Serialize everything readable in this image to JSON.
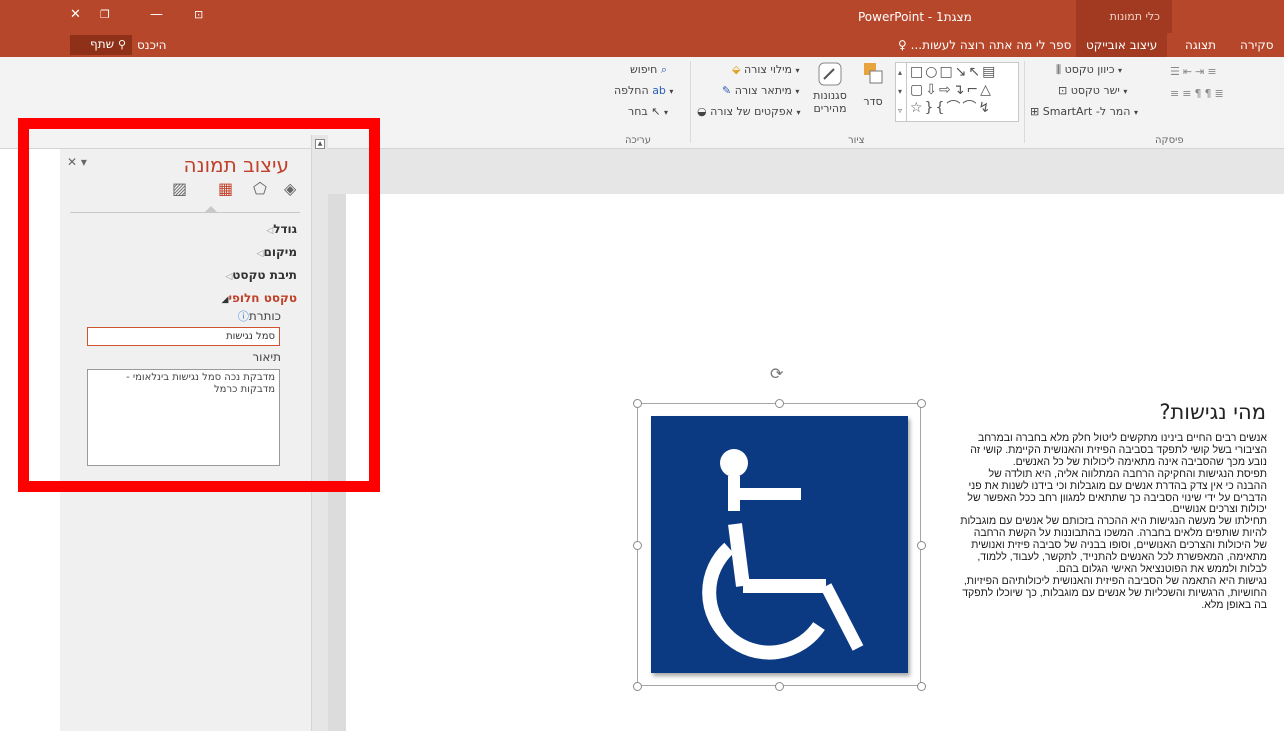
{
  "titlebar": {
    "title": "מצגת1 - PowerPoint",
    "context_tab_group": "כלי תמונות"
  },
  "tabs": {
    "share": "שתף",
    "signin": "היכנס",
    "tell_me": "ספר לי מה אתה רוצה לעשות...",
    "items": [
      "סקירה",
      "תצוגה",
      "עיצוב אובייקט"
    ]
  },
  "ribbon": {
    "editing": {
      "find": "חיפוש",
      "replace": "החלפה",
      "select": "בחר",
      "group_label": "עריכה"
    },
    "drawing": {
      "shape_fill": "מילוי צורה",
      "shape_outline": "מיתאר צורה",
      "shape_effects": "אפקטים של צורה",
      "quick_styles_line1": "סגנונות",
      "quick_styles_line2": "מהירים",
      "arrange": "סדר",
      "group_label": "ציור"
    },
    "paragraph": {
      "text_direction": "כיוון טקסט",
      "align_text": "ישר טקסט",
      "convert_smartart": "המר ל- SmartArt",
      "group_label": "פיסקה"
    }
  },
  "pane": {
    "title": "עיצוב תמונה",
    "sections": {
      "size": "גודל",
      "position": "מיקום",
      "textbox": "תיבת טקסט",
      "alt_text": "טקסט חלופי"
    },
    "alt_title_label": "כותרת",
    "alt_title_value": "סמל נגישות",
    "alt_desc_label": "תיאור",
    "alt_desc_value": "מדבקת נכה סמל נגישות בינלאומי - מדבקות כרמל"
  },
  "slide": {
    "heading": "מהי נגישות?",
    "paragraphs": [
      "אנשים רבים החיים בינינו מתקשים ליטול חלק מלא בחברה ובמרחב הציבורי בשל קושי לתפקד בסביבה הפיזית והאנושית הקיימת. קושי זה נובע מכך שהסביבה אינה מתאימה ליכולות של כל האנשים.",
      "תפיסת הנגישות והחקיקה הרחבה המתלווה אליה, היא תולדה של ההבנה כי אין צדק בהדרת אנשים עם מוגבלות וכי בידנו לשנות את פני הדברים על ידי שינוי הסביבה כך שתתאים למגוון רחב ככל האפשר של יכולות וצרכים אנושיים.",
      "תחילתו של מעשה הנגישות היא ההכרה בזכותם של אנשים עם מוגבלות להיות שותפים מלאים בחברה. המשכו בהתבוננות על הקשת הרחבה של היכולות והצרכים האנושיים, וסופו בבניה של סביבה פיזית ואנושית מתאימה, המאפשרת לכל האנשים להתנייד, לתקשר, לעבוד, ללמוד, לבלות ולממש את הפוטנציאל האישי הגלום בהם.",
      "נגישות היא התאמה של הסביבה הפיזית והאנושית ליכולותיהם הפיזיות, החושיות, הרגשיות והשכליות של אנשים עם מוגבלות, כך שיוכלו לתפקד בה באופן מלא."
    ]
  },
  "colors": {
    "accent": "#b7472a",
    "pane_accent": "#c0402a",
    "symbol_blue": "#0b3a82",
    "annotation_red": "#ff0000"
  },
  "icons": {
    "close": "close-icon",
    "restore": "restore-icon",
    "minimize": "minimize-icon",
    "ribbon_display": "ribbon-display-options-icon",
    "person": "person-icon",
    "lightbulb": "lightbulb-icon",
    "wheelchair": "wheelchair-accessibility-icon"
  }
}
